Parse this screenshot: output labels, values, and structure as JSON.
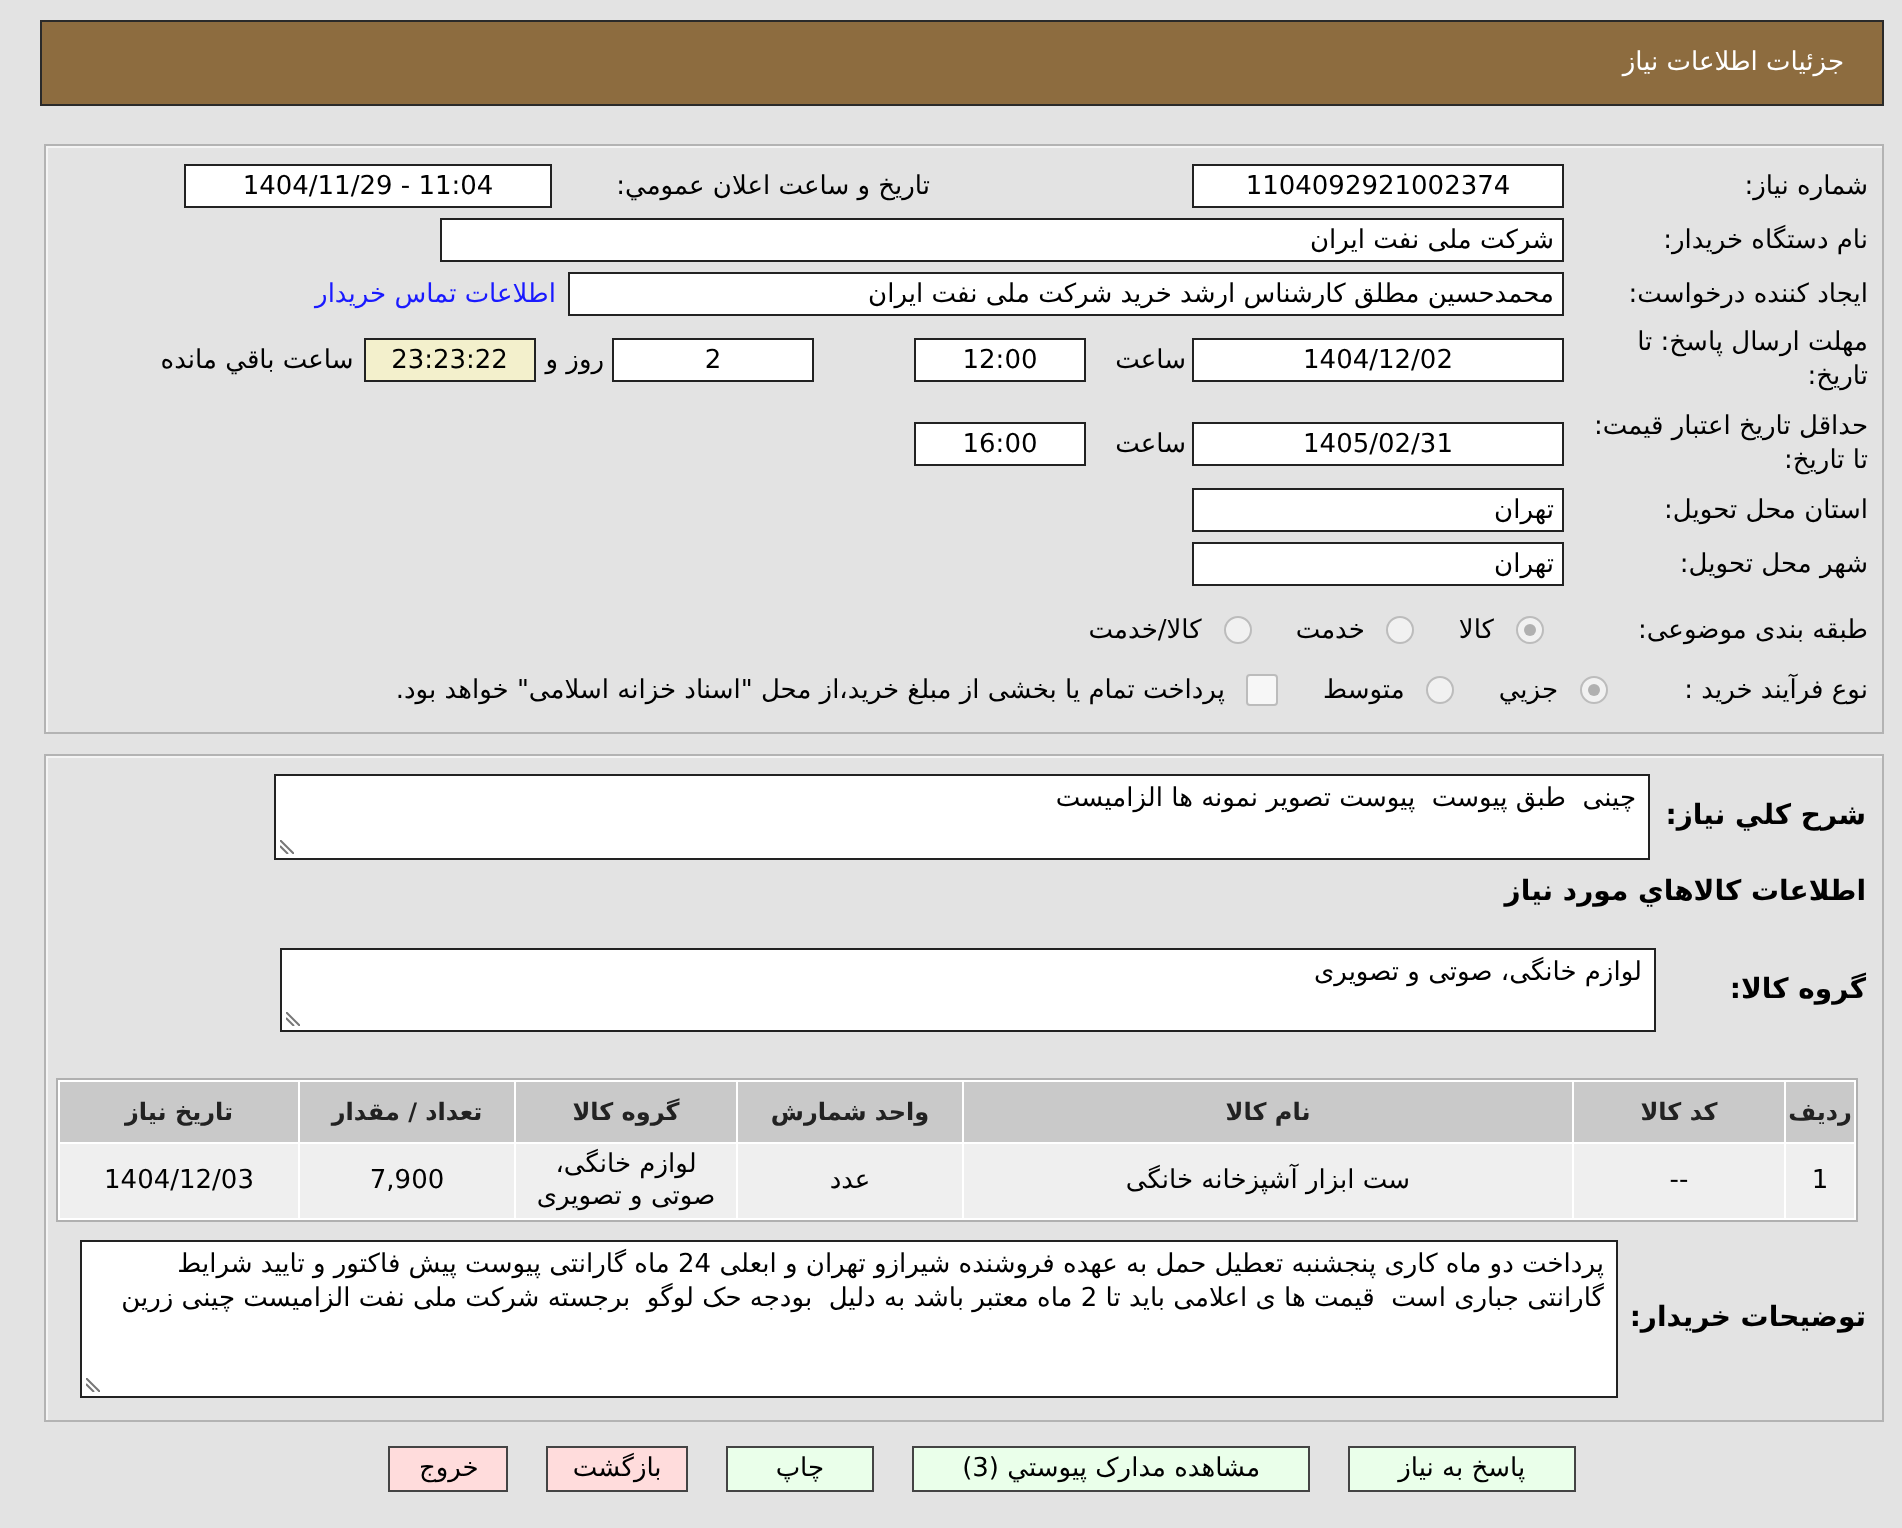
{
  "header": {
    "title": "جزئیات اطلاعات نیاز"
  },
  "info": {
    "need_number": {
      "label": "شماره نیاز:",
      "value": "1104092921002374"
    },
    "announce": {
      "label": "تاریخ و ساعت اعلان عمومي:",
      "value": "1404/11/29 - 11:04"
    },
    "buyer_org": {
      "label": "نام دستگاه خریدار:",
      "value": "شرکت ملی نفت ایران"
    },
    "requester": {
      "label": "ایجاد کننده درخواست:",
      "value": "محمدحسین مطلق کارشناس ارشد خرید شرکت ملی نفت ایران",
      "link": "اطلاعات تماس خریدار"
    },
    "reply_deadline": {
      "label": "مهلت ارسال پاسخ: تا تاریخ:",
      "date": "1404/12/02",
      "time_label": "ساعت",
      "time": "12:00",
      "days": "2",
      "days_label": "روز و",
      "remaining": "23:23:22",
      "remaining_label": "ساعت باقي مانده"
    },
    "price_validity": {
      "label": "حداقل تاریخ اعتبار قیمت: تا تاریخ:",
      "date": "1405/02/31",
      "time_label": "ساعت",
      "time": "16:00"
    },
    "province": {
      "label": "استان محل تحویل:",
      "value": "تهران"
    },
    "city": {
      "label": "شهر محل تحویل:",
      "value": "تهران"
    },
    "category": {
      "label": "طبقه بندی موضوعی:",
      "options": [
        {
          "label": "کالا",
          "selected": true,
          "disabled": true
        },
        {
          "label": "خدمت",
          "selected": false,
          "disabled": true
        },
        {
          "label": "کالا/خدمت",
          "selected": false,
          "disabled": true
        }
      ]
    },
    "process": {
      "label": "نوع فرآیند خرید :",
      "options": [
        {
          "label": "جزيي",
          "selected": true,
          "disabled": true
        },
        {
          "label": "متوسط",
          "selected": false,
          "disabled": true
        }
      ],
      "treasury": {
        "label": "پرداخت تمام یا بخشی از مبلغ خرید،از محل \"اسناد خزانه اسلامی\" خواهد بود.",
        "checked": false,
        "disabled": true
      }
    }
  },
  "needs": {
    "summary": {
      "label": "شرح کلي نیاز:",
      "value": "چینی  طبق پیوست  پیوست تصویر نمونه ها الزامیست"
    },
    "goods_heading": "اطلاعات کالاهاي مورد نیاز",
    "goods_group": {
      "label": "گروه کالا:",
      "value": "لوازم خانگی، صوتی و تصویری"
    },
    "table": {
      "columns": [
        "ردیف",
        "کد کالا",
        "نام کالا",
        "واحد شمارش",
        "گروه کالا",
        "تعداد / مقدار",
        "تاریخ نیاز"
      ],
      "rows": [
        [
          "1",
          "--",
          "ست ابزار آشپزخانه خانگی",
          "عدد",
          "لوازم خانگی، صوتی و تصویری",
          "7,900",
          "1404/12/03"
        ]
      ]
    },
    "buyer_notes": {
      "label": "توضیحات خریدار:",
      "value": "پرداخت دو ماه کاری پنجشنبه تعطیل حمل به عهده فروشنده شیرازو تهران و ابعلی 24 ماه گارانتی پیوست پیش فاکتور و تایید شرایط گارانتی جباری است  قیمت ها ی اعلامی باید تا 2 ماه معتبر باشد به دلیل  بودجه حک لوگو  برجسته شرکت ملی نفت الزامیست چینی زرین"
    }
  },
  "buttons": [
    {
      "label": "پاسخ به نیاز",
      "kind": "action"
    },
    {
      "label": "مشاهده مدارک پیوستي (3)",
      "kind": "action"
    },
    {
      "label": "چاپ",
      "kind": "action"
    },
    {
      "label": "بازگشت",
      "kind": "exit"
    },
    {
      "label": "خروج",
      "kind": "exit"
    }
  ]
}
